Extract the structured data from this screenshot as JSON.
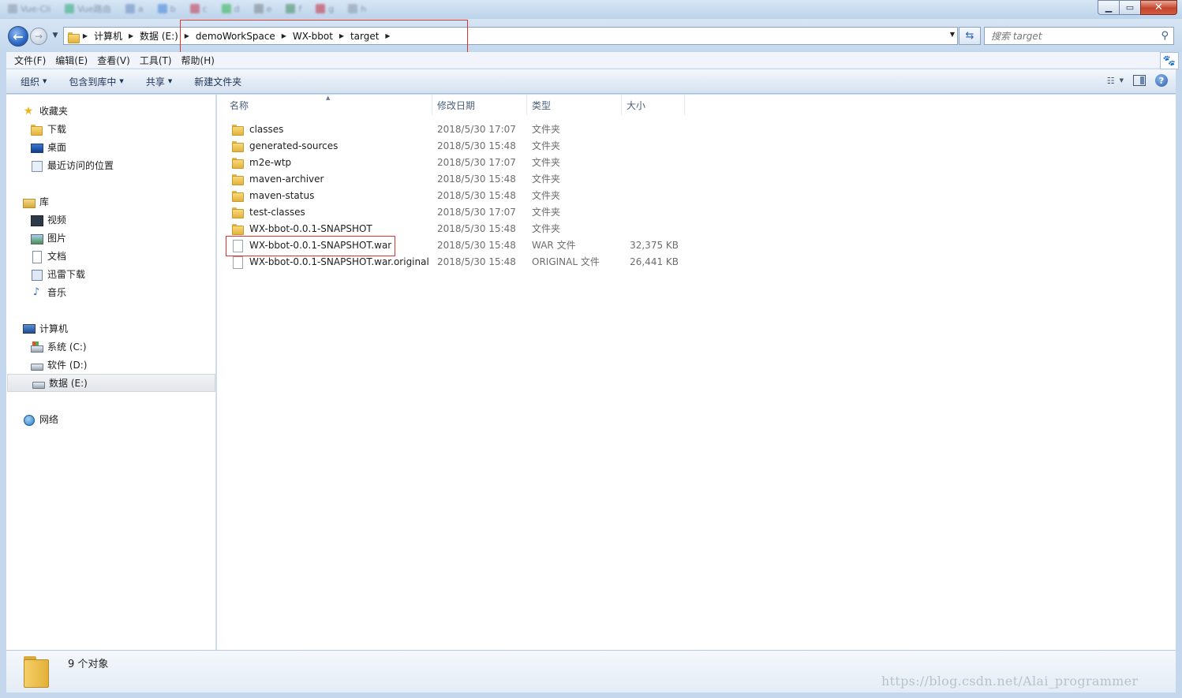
{
  "window": {
    "blurred_tabs": [
      "Vue-Cli",
      "Vue路由",
      "a",
      "b",
      "c",
      "d",
      "e",
      "f",
      "g",
      "h"
    ],
    "minimize_label": "▁",
    "maximize_label": "▭",
    "close_label": "✕"
  },
  "address_bar": {
    "crumbs": [
      "计算机",
      "数据 (E:)",
      "demoWorkSpace",
      "WX-bbot",
      "target"
    ]
  },
  "search": {
    "placeholder": "搜索 target"
  },
  "menu": [
    "文件(F)",
    "编辑(E)",
    "查看(V)",
    "工具(T)",
    "帮助(H)"
  ],
  "toolbar": {
    "organize": "组织",
    "include_in_library": "包含到库中",
    "share": "共享",
    "new_folder": "新建文件夹"
  },
  "sidebar": {
    "favorites": {
      "label": "收藏夹",
      "items": [
        "下载",
        "桌面",
        "最近访问的位置"
      ]
    },
    "libraries": {
      "label": "库",
      "items": [
        "视频",
        "图片",
        "文档",
        "迅雷下载",
        "音乐"
      ]
    },
    "computer": {
      "label": "计算机",
      "items": [
        "系统 (C:)",
        "软件 (D:)",
        "数据 (E:)"
      ]
    },
    "network": {
      "label": "网络"
    }
  },
  "columns": {
    "name": "名称",
    "date": "修改日期",
    "type": "类型",
    "size": "大小"
  },
  "files": [
    {
      "name": "classes",
      "date": "2018/5/30 17:07",
      "type": "文件夹",
      "size": "",
      "kind": "folder"
    },
    {
      "name": "generated-sources",
      "date": "2018/5/30 15:48",
      "type": "文件夹",
      "size": "",
      "kind": "folder"
    },
    {
      "name": "m2e-wtp",
      "date": "2018/5/30 17:07",
      "type": "文件夹",
      "size": "",
      "kind": "folder"
    },
    {
      "name": "maven-archiver",
      "date": "2018/5/30 15:48",
      "type": "文件夹",
      "size": "",
      "kind": "folder"
    },
    {
      "name": "maven-status",
      "date": "2018/5/30 15:48",
      "type": "文件夹",
      "size": "",
      "kind": "folder"
    },
    {
      "name": "test-classes",
      "date": "2018/5/30 17:07",
      "type": "文件夹",
      "size": "",
      "kind": "folder"
    },
    {
      "name": "WX-bbot-0.0.1-SNAPSHOT",
      "date": "2018/5/30 15:48",
      "type": "文件夹",
      "size": "",
      "kind": "folder"
    },
    {
      "name": "WX-bbot-0.0.1-SNAPSHOT.war",
      "date": "2018/5/30 15:48",
      "type": "WAR 文件",
      "size": "32,375 KB",
      "kind": "file"
    },
    {
      "name": "WX-bbot-0.0.1-SNAPSHOT.war.original",
      "date": "2018/5/30 15:48",
      "type": "ORIGINAL 文件",
      "size": "26,441 KB",
      "kind": "file"
    }
  ],
  "status": {
    "count_text": "9 个对象"
  },
  "watermark": "https://blog.csdn.net/Alai_programmer",
  "colors": {
    "highlight": "#e0322c",
    "accent": "#2c68c4"
  }
}
